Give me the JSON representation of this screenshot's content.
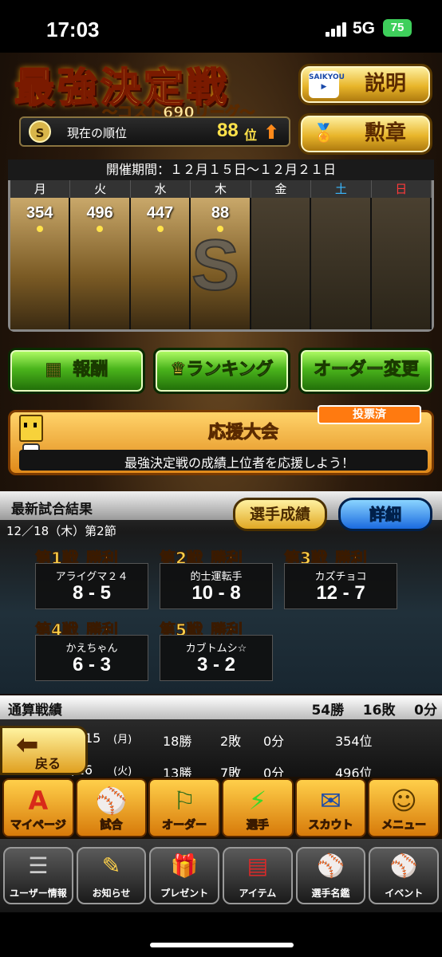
{
  "status_bar": {
    "time": "17:03",
    "network": "5G",
    "battery": "75"
  },
  "header": {
    "title": "最強決定戦",
    "subtitle": "〜コスト690リーグ〜",
    "rank_badge": "S",
    "rank_label": "現在の順位",
    "rank_value": "88",
    "rank_unit": "位",
    "rank_trend_icon": "up-arrow-icon",
    "explain_button": "説明",
    "explain_button_tag": "SAIKYOU",
    "medal_button": "勲章"
  },
  "calendar": {
    "period": "開催期間：１２月１５日〜１２月２１日",
    "days": [
      {
        "label": "月",
        "color": "#ffffff",
        "value": "354",
        "active": true
      },
      {
        "label": "火",
        "color": "#ffffff",
        "value": "496",
        "active": true
      },
      {
        "label": "水",
        "color": "#ffffff",
        "value": "447",
        "active": true
      },
      {
        "label": "木",
        "color": "#ffffff",
        "value": "88",
        "active": true
      },
      {
        "label": "金",
        "color": "#ffffff",
        "value": "",
        "active": false
      },
      {
        "label": "土",
        "color": "#3ab8ff",
        "value": "",
        "active": false
      },
      {
        "label": "日",
        "color": "#ff3a3a",
        "value": "",
        "active": false
      }
    ],
    "emblem": "S"
  },
  "actions": {
    "reward": "報酬",
    "ranking": "ランキング",
    "order_change": "オーダー変更"
  },
  "cheer": {
    "title": "応援大会",
    "voted_badge": "投票済",
    "message": "最強決定戦の成績上位者を応援しよう！"
  },
  "latest_results": {
    "title": "最新試合結果",
    "date": "12／18（木）第2節",
    "player_stats_button": "選手成績",
    "detail_button": "詳細",
    "games": [
      {
        "label": "第1戦",
        "result": "勝利",
        "opponent": "アライグマ２４",
        "score": "8 - 5"
      },
      {
        "label": "第2戦",
        "result": "勝利",
        "opponent": "的士運転手",
        "score": "10 - 8"
      },
      {
        "label": "第3戦",
        "result": "勝利",
        "opponent": "カズチョコ",
        "score": "12 - 7"
      },
      {
        "label": "第4戦",
        "result": "勝利",
        "opponent": "かえちゃん",
        "score": "6 - 3"
      },
      {
        "label": "第5戦",
        "result": "勝利",
        "opponent": "カブトムシ☆",
        "score": "3 - 2"
      }
    ]
  },
  "totals": {
    "label": "通算戦績",
    "wins": "54勝",
    "losses": "16敗",
    "draws": "0分"
  },
  "history": [
    {
      "date": "15",
      "day": "(月)",
      "wins": "18勝",
      "losses": "2敗",
      "draws": "0分",
      "rank": "354位"
    },
    {
      "date": "12/16",
      "day": "(火)",
      "wins": "13勝",
      "losses": "7敗",
      "draws": "0分",
      "rank": "496位"
    }
  ],
  "back_button": "戻る",
  "nav_primary": [
    {
      "label": "マイページ",
      "icon": "mypage-icon",
      "glyph": "A"
    },
    {
      "label": "試合",
      "icon": "stadium-icon",
      "glyph": "⚾"
    },
    {
      "label": "オーダー",
      "icon": "order-icon",
      "glyph": "⚐"
    },
    {
      "label": "選手",
      "icon": "player-icon",
      "glyph": "⚡"
    },
    {
      "label": "スカウト",
      "icon": "scout-icon",
      "glyph": "✉"
    },
    {
      "label": "メニュー",
      "icon": "menu-icon",
      "glyph": "☺"
    }
  ],
  "nav_secondary": [
    {
      "label": "ユーザー情報",
      "icon": "user-info-icon",
      "glyph": "☰"
    },
    {
      "label": "お知らせ",
      "icon": "news-icon",
      "glyph": "✎"
    },
    {
      "label": "プレゼント",
      "icon": "present-icon",
      "glyph": "🎁"
    },
    {
      "label": "アイテム",
      "icon": "item-icon",
      "glyph": "▤"
    },
    {
      "label": "選手名鑑",
      "icon": "player-book-icon",
      "glyph": "⚾"
    },
    {
      "label": "イベント",
      "icon": "event-icon",
      "glyph": "⚾"
    }
  ]
}
